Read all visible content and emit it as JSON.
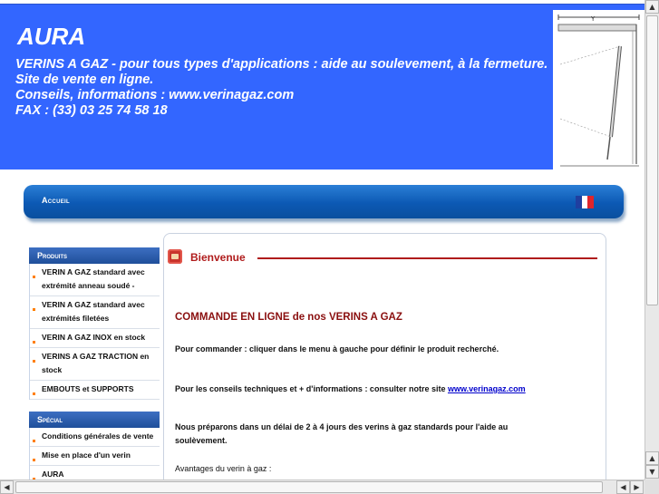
{
  "header": {
    "site_title": "AURA",
    "tagline": [
      "VERINS A GAZ - pour tous types d'applications : aide au soulevement, à la fermeture.",
      "Site de vente en ligne.",
      "Conseils, informations : www.verinagaz.com",
      "FAX : (33) 03 25 74 58 18"
    ],
    "diagram_label": "Y"
  },
  "nav": {
    "home_label": "Accueil",
    "language_flag": "french-flag-icon"
  },
  "sidebar": {
    "products_heading": "Produits",
    "products": [
      "VERIN A GAZ standard avec extrémité anneau soudé -",
      "VERIN A GAZ standard avec extrémités filetées",
      "VERIN A GAZ INOX en stock",
      "VERINS A GAZ TRACTION en stock",
      "EMBOUTS et SUPPORTS"
    ],
    "special_heading": "Spécial",
    "special": [
      "Conditions générales de vente",
      "Mise en place d'un verin",
      "AURA"
    ]
  },
  "content": {
    "welcome_title": "Bienvenue",
    "order_title": "COMMANDE EN LIGNE de nos VERINS A GAZ",
    "order_text": "Pour commander : cliquer dans le menu à gauche pour définir le produit recherché.",
    "advice_text": "Pour les conseils techniques et + d'informations : consulter notre site",
    "advice_link": "www.verinagaz.com",
    "delay_text": "Nous préparons  dans un délai de 2 à 4 jours des verins à gaz standards pour l'aide au soulèvement.",
    "advantages_text": "Avantages du verin à gaz :"
  },
  "colors": {
    "header_blue": "#3366ff",
    "nav_blue": "#0c59b4",
    "title_red": "#b01c1c",
    "bullet_orange": "#ff7f00"
  }
}
